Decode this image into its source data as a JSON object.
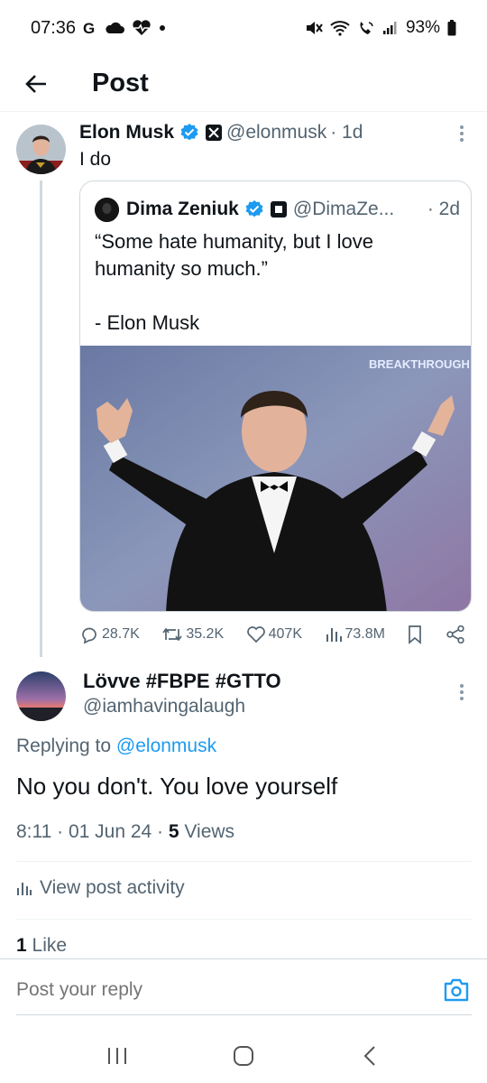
{
  "status_bar": {
    "time": "07:36",
    "battery": "93%"
  },
  "header": {
    "title": "Post"
  },
  "main_tweet": {
    "author_name": "Elon Musk",
    "handle": "@elonmusk",
    "age": "· 1d",
    "text": "I do",
    "quote": {
      "author_name": "Dima Zeniuk",
      "handle": "@DimaZe...",
      "age": "· 2d",
      "text": "“Some hate humanity, but I love humanity so much.”\n\n- Elon Musk",
      "image_banner_text": "BREAKTHROUGH PRIZE"
    },
    "actions": {
      "replies": "28.7K",
      "reposts": "35.2K",
      "likes": "407K",
      "views": "73.8M"
    }
  },
  "reply_tweet": {
    "author_name": "Lövve #FBPE #GTTO",
    "handle": "@iamhavingalaugh",
    "replying_prefix": "Replying to",
    "replying_to": "@elonmusk",
    "text": "No you don't. You love yourself",
    "time": "8:11 · 01 Jun 24 · ",
    "views_count": "5",
    "views_label": " Views",
    "activity_label": "View post activity",
    "like_count": "1",
    "like_label": " Like"
  },
  "composer": {
    "placeholder": "Post your reply"
  },
  "colors": {
    "accent": "#1d9bf0",
    "text_primary": "#0f1419",
    "text_secondary": "#536471",
    "border": "#cfd9de"
  },
  "icons": [
    "back-arrow-icon",
    "verified-badge-icon",
    "x-affiliate-icon",
    "reply-icon",
    "repost-icon",
    "like-icon",
    "views-icon",
    "bookmark-icon",
    "share-icon",
    "more-icon",
    "camera-icon",
    "activity-icon"
  ]
}
